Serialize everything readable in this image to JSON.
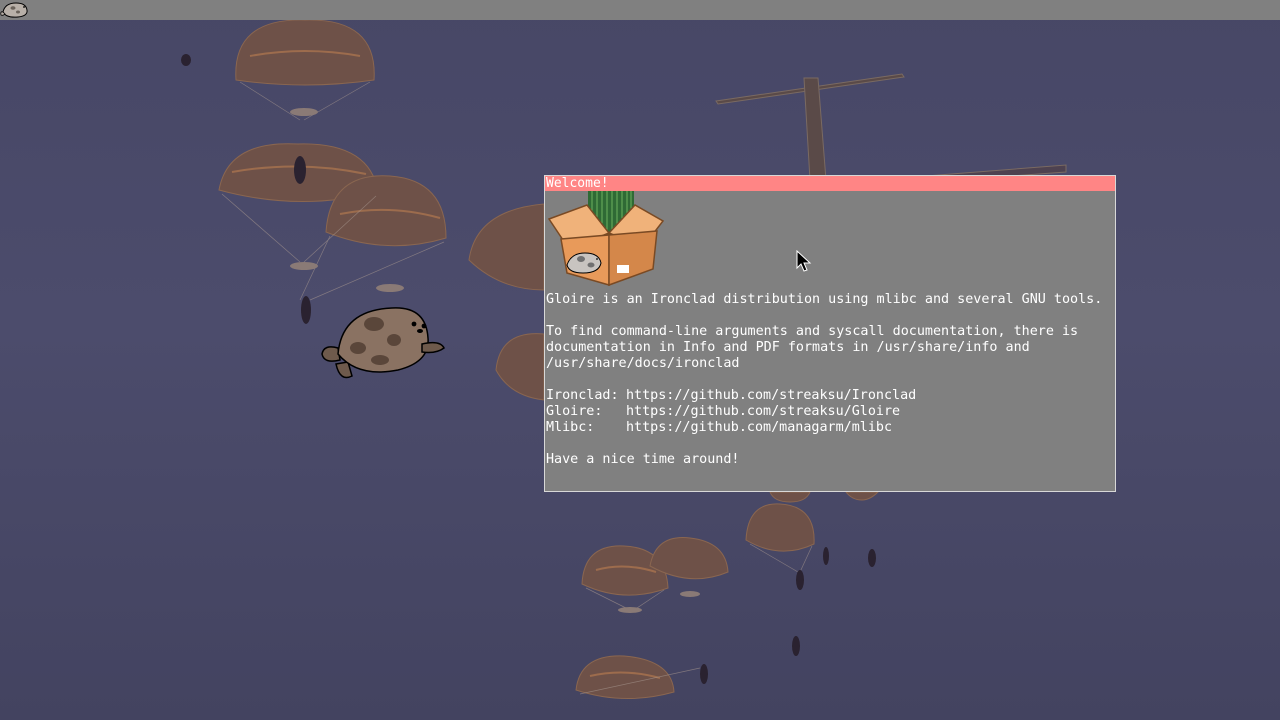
{
  "window": {
    "title": "Welcome!",
    "intro": "Gloire is an Ironclad distribution using mlibc and several GNU tools.",
    "docs_lines": [
      "To find command-line arguments and syscall documentation, there is",
      "documentation in Info and PDF formats in /usr/share/info and",
      "/usr/share/docs/ironclad"
    ],
    "links": [
      {
        "label": "Ironclad:",
        "url": "https://github.com/streaksu/Ironclad"
      },
      {
        "label": "Gloire:",
        "url": "https://github.com/streaksu/Gloire"
      },
      {
        "label": "Mlibc:",
        "url": "https://github.com/managarm/mlibc"
      }
    ],
    "closing": "Have a nice time around!"
  },
  "colors": {
    "taskbar": "#808080",
    "window_bg": "#808080",
    "titlebar": "#ff8585",
    "text": "#ffffff"
  },
  "icons": {
    "taskbar_logo": "seal-icon",
    "box": "box-icon",
    "cursor": "cursor-icon",
    "desktop_seal": "seal-icon"
  }
}
